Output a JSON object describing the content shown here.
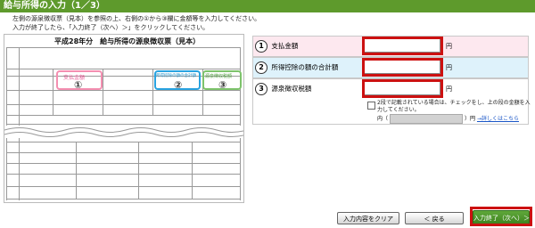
{
  "page": {
    "title": "給与所得の入力（1／3）"
  },
  "instructions": [
    "左側の源泉徴収票（見本）を参照の上、右側の①から③欄に金額等を入力してください。",
    "入力が終了したら、「入力終了（次へ）＞」をクリックしてください。"
  ],
  "sample_doc": {
    "title": "平成28年分　給与所得の源泉徴収票（見本）",
    "highlight_1": "支払金額",
    "highlight_2": "所得控除の額の合計額",
    "highlight_3": "源泉徴収税額",
    "num_1": "①",
    "num_2": "②",
    "num_3": "③"
  },
  "form": {
    "rows": [
      {
        "num": "1",
        "label": "支払金額",
        "unit": "円",
        "value": ""
      },
      {
        "num": "2",
        "label": "所得控除の額の合計額",
        "unit": "円",
        "value": ""
      },
      {
        "num": "3",
        "label": "源泉徴収税額",
        "unit": "円",
        "value": ""
      }
    ],
    "note": "2段で記載されている場合は、チェックをし、上の段の金額を入力してください。",
    "inner_prefix": "内（",
    "inner_suffix": "）円",
    "detail_link": "→詳しくはこちら"
  },
  "buttons": {
    "clear": "入力内容をクリア",
    "back": "＜ 戻る",
    "next": "入力終了（次へ）＞"
  },
  "colors": {
    "title_bar": "#5e9a2c",
    "required_outline": "#cc1111",
    "label_bg_1": "#fde8ef",
    "label_bg_2": "#def2fb",
    "label_bg_3": "#ffffff"
  }
}
